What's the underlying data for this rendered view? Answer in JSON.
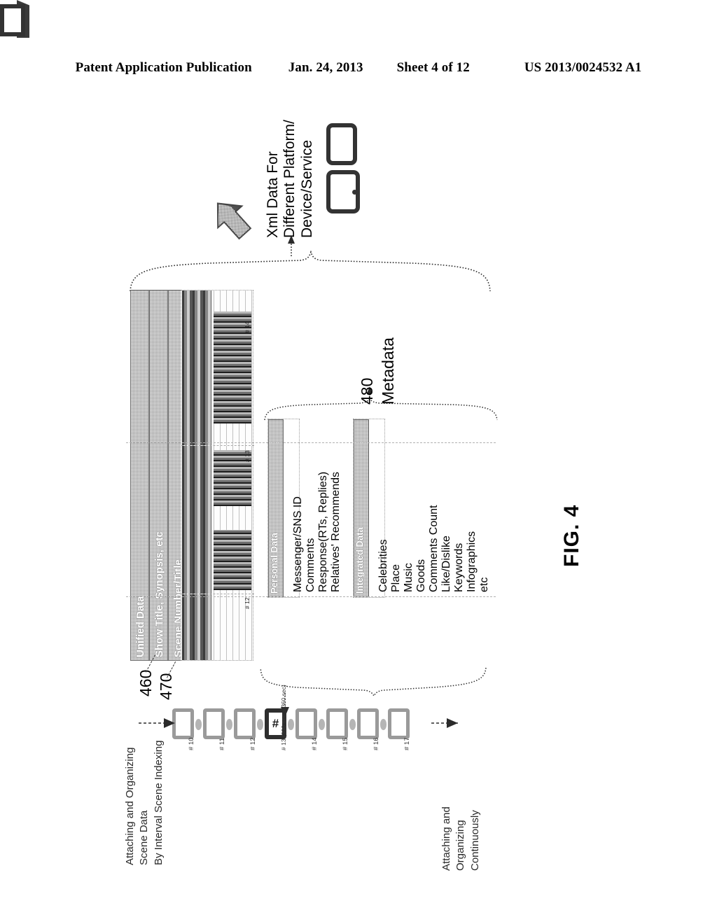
{
  "header": {
    "publication": "Patent Application Publication",
    "date": "Jan. 24, 2013",
    "sheet": "Sheet 4 of 12",
    "number": "US 2013/0024532 A1"
  },
  "figure": {
    "label": "FIG. 4"
  },
  "xml_output": {
    "caption": "Xml Data For\nDifferent Platform/\nDevice/Service",
    "caption_line1": "Xml Data For",
    "caption_line2": "Different Platform/",
    "caption_line3": "Device/Service",
    "icons": [
      "upload-arrow-icon",
      "tablet-device-icon",
      "phone-device-icon",
      "feature-phone-icon"
    ]
  },
  "unified_data": {
    "ref_460": "460",
    "ref_470": "470",
    "rows": [
      {
        "label": "Unified Data"
      },
      {
        "label": "Show Title, Synopsis, etc"
      },
      {
        "label": "Scene Number/Title"
      }
    ]
  },
  "scenes_panel": {
    "cells": [
      {
        "tag": "# 14"
      },
      {
        "tag": "# 13"
      },
      {
        "tag": "# 12"
      }
    ]
  },
  "metadata": {
    "ref": "480",
    "label": "Metadata",
    "panels": [
      {
        "name": "personal-data",
        "header": "Personal Data",
        "items": [
          "Messenger/SNS ID",
          "Comments",
          "Response(RTs, Replies)",
          "Relatives' Recommends"
        ]
      },
      {
        "name": "integrated-data",
        "header": "Integrated Data",
        "items": [
          "Celebrities",
          "Place",
          "Music",
          "Goods",
          "Comments Count",
          "Like/Dislike",
          "Keywords",
          "Infographics",
          "etc"
        ]
      }
    ]
  },
  "timeline": {
    "caption_top_line1": "Attaching and Organizing",
    "caption_top_line2": "Scene Data",
    "caption_top_line3": "By Interval Scene Indexing",
    "caption_bottom_line1": "Attaching and",
    "caption_bottom_line2": "Organizing",
    "caption_bottom_line3": "Continuously",
    "scenes": [
      {
        "tag": "# 10",
        "current": false,
        "glyph": ""
      },
      {
        "tag": "# 11",
        "current": false,
        "glyph": ""
      },
      {
        "tag": "# 12",
        "current": false,
        "glyph": ""
      },
      {
        "tag": "# 13 (300 sec ~ 360 sec)",
        "current": true,
        "glyph": "#"
      },
      {
        "tag": "# 14",
        "current": false,
        "glyph": ""
      },
      {
        "tag": "# 15",
        "current": false,
        "glyph": ""
      },
      {
        "tag": "# 16",
        "current": false,
        "glyph": ""
      },
      {
        "tag": "# 17",
        "current": false,
        "glyph": ""
      }
    ]
  },
  "colors": {
    "ink": "#000000",
    "panel_gray": "#8c8c8c",
    "scene_box_border": "#9a9a9a",
    "scene_box_current": "#2e2e2e",
    "paper": "#ffffff"
  }
}
